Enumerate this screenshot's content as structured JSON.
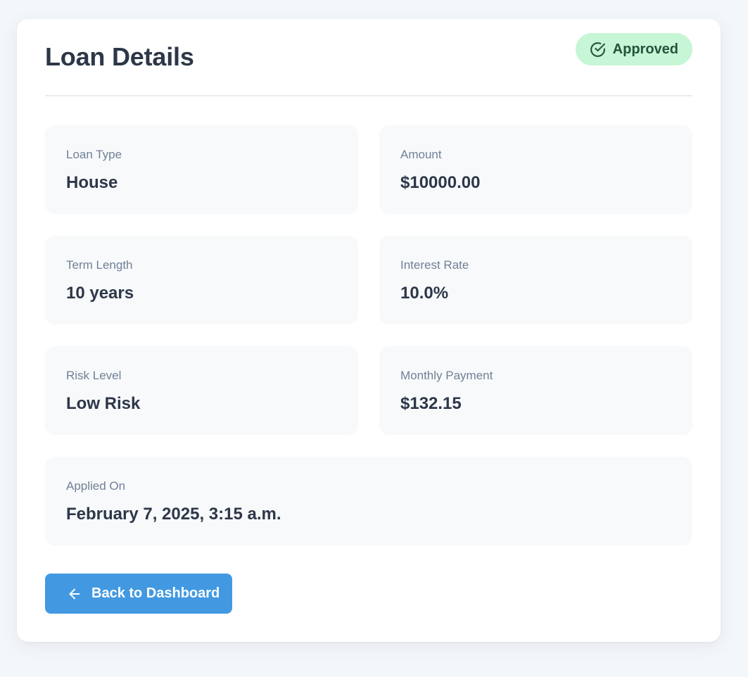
{
  "page": {
    "title": "Loan Details",
    "status": {
      "label": "Approved",
      "icon": "check-circle-icon",
      "bg_color": "#c6f6d5",
      "text_color": "#22543d"
    }
  },
  "details": {
    "loan_type": {
      "label": "Loan Type",
      "value": "House"
    },
    "amount": {
      "label": "Amount",
      "value": "$10000.00"
    },
    "term_length": {
      "label": "Term Length",
      "value": "10 years"
    },
    "interest_rate": {
      "label": "Interest Rate",
      "value": "10.0%"
    },
    "risk_level": {
      "label": "Risk Level",
      "value": "Low Risk"
    },
    "monthly_payment": {
      "label": "Monthly Payment",
      "value": "$132.15"
    },
    "applied_on": {
      "label": "Applied On",
      "value": "February 7, 2025, 3:15 a.m."
    }
  },
  "actions": {
    "back": {
      "label": "Back to Dashboard",
      "icon": "arrow-left-icon",
      "color": "#4299e1"
    }
  }
}
